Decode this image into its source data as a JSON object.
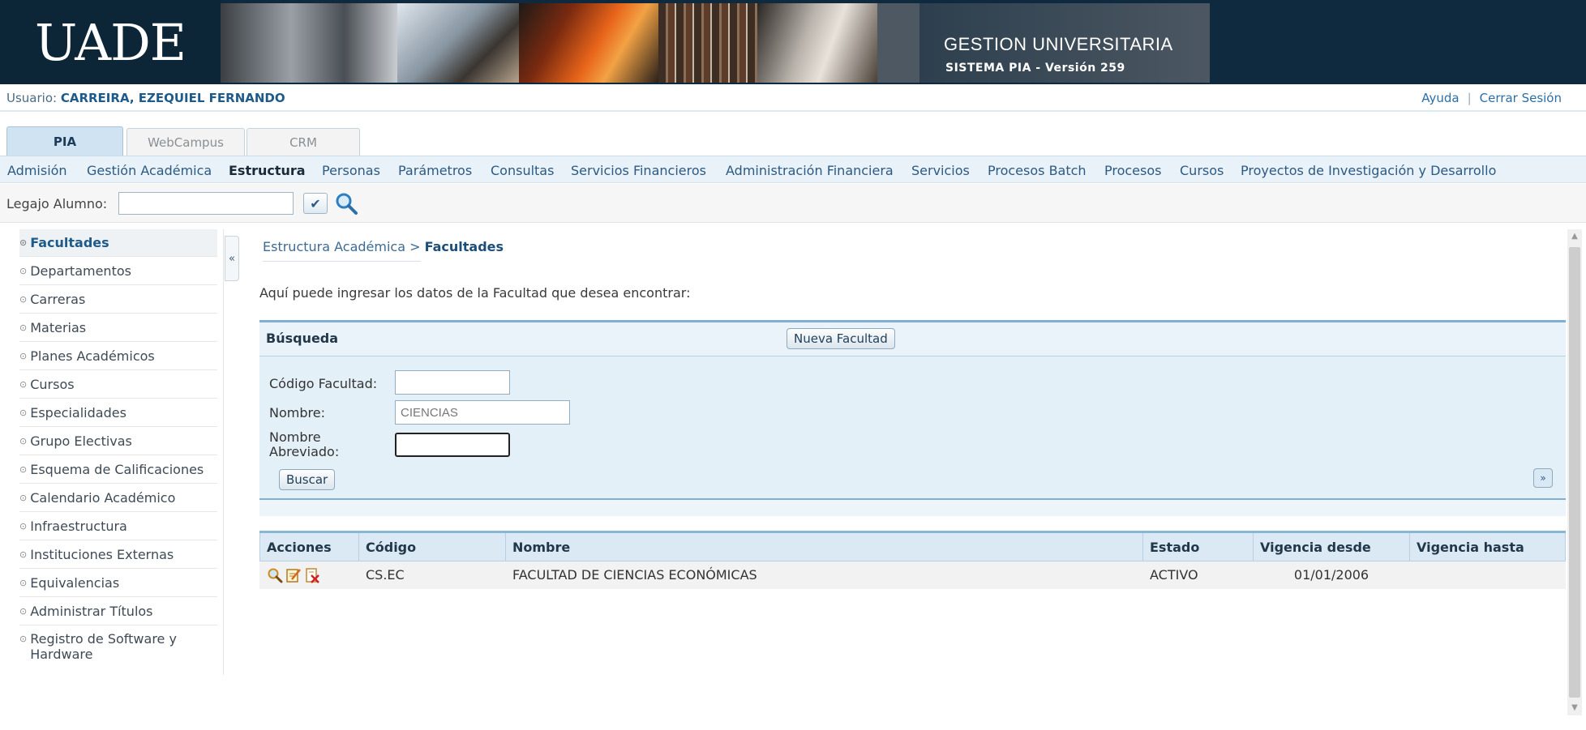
{
  "header": {
    "logo": "UADE",
    "system_title": "GESTION UNIVERSITARIA",
    "system_subtitle": "SISTEMA PIA - Versión 259"
  },
  "userbar": {
    "user_label": "Usuario:",
    "user_name": "CARREIRA, EZEQUIEL FERNANDO",
    "help": "Ayuda",
    "logout": "Cerrar Sesión"
  },
  "tabs": [
    {
      "label": "PIA",
      "active": true
    },
    {
      "label": "WebCampus",
      "active": false
    },
    {
      "label": "CRM",
      "active": false
    }
  ],
  "menu": [
    {
      "label": "Admisión"
    },
    {
      "label": "Gestión Académica"
    },
    {
      "label": "Estructura",
      "active": true
    },
    {
      "label": "Personas"
    },
    {
      "label": "Parámetros"
    },
    {
      "label": "Consultas"
    },
    {
      "label": "Servicios Financieros"
    },
    {
      "label": "Administración Financiera"
    },
    {
      "label": "Servicios"
    },
    {
      "label": "Procesos Batch"
    },
    {
      "label": "Procesos"
    },
    {
      "label": "Cursos"
    },
    {
      "label": "Proyectos de Investigación y Desarrollo"
    }
  ],
  "legajo": {
    "label": "Legajo Alumno:",
    "value": ""
  },
  "sidebar": {
    "items": [
      {
        "label": "Facultades",
        "active": true
      },
      {
        "label": "Departamentos"
      },
      {
        "label": "Carreras"
      },
      {
        "label": "Materias"
      },
      {
        "label": "Planes Académicos"
      },
      {
        "label": "Cursos"
      },
      {
        "label": "Especialidades"
      },
      {
        "label": "Grupo Electivas"
      },
      {
        "label": "Esquema de Calificaciones"
      },
      {
        "label": "Calendario Académico"
      },
      {
        "label": "Infraestructura"
      },
      {
        "label": "Instituciones Externas"
      },
      {
        "label": "Equivalencias"
      },
      {
        "label": "Administrar Títulos"
      },
      {
        "label": "Registro de Software y Hardware"
      }
    ],
    "collapse_glyph": "«"
  },
  "breadcrumb": {
    "parent": "Estructura Académica",
    "separator": ">",
    "current": "Facultades"
  },
  "intro": "Aquí puede ingresar los datos de la Facultad que desea encontrar:",
  "search": {
    "title": "Búsqueda",
    "new_button": "Nueva Facultad",
    "fields": {
      "codigo_label": "Código Facultad:",
      "codigo_value": "",
      "nombre_label": "Nombre:",
      "nombre_value": "CIENCIAS",
      "abreviado_label_1": "Nombre",
      "abreviado_label_2": "Abreviado:",
      "abreviado_value": ""
    },
    "search_button": "Buscar"
  },
  "results": {
    "columns": [
      "Acciones",
      "Código",
      "Nombre",
      "Estado",
      "Vigencia desde",
      "Vigencia hasta"
    ],
    "rows": [
      {
        "codigo": "CS.EC",
        "nombre": "FACULTAD DE CIENCIAS ECONÓMICAS",
        "estado": "ACTIVO",
        "desde": "01/01/2006",
        "hasta": ""
      }
    ],
    "actions": [
      "view-icon",
      "edit-icon",
      "delete-icon"
    ]
  },
  "colors": {
    "banner": "#0f2a3e",
    "accent": "#1e5a8a",
    "panel": "#e4f0f7"
  }
}
